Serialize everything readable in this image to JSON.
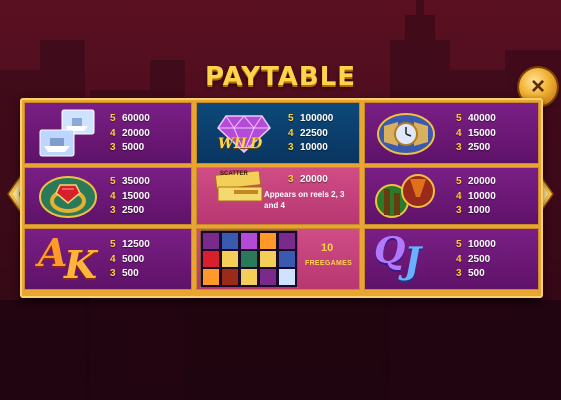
{
  "title": "PAYTABLE",
  "close_label": "×",
  "cells": {
    "yachts": {
      "pays": [
        [
          "5",
          "60000"
        ],
        [
          "4",
          "20000"
        ],
        [
          "3",
          "5000"
        ]
      ]
    },
    "wild": {
      "symbol_text": "WILD",
      "pays": [
        [
          "5",
          "100000"
        ],
        [
          "4",
          "22500"
        ],
        [
          "3",
          "10000"
        ]
      ]
    },
    "watch": {
      "pays": [
        [
          "5",
          "40000"
        ],
        [
          "4",
          "15000"
        ],
        [
          "3",
          "2500"
        ]
      ]
    },
    "ring": {
      "pays": [
        [
          "5",
          "35000"
        ],
        [
          "4",
          "15000"
        ],
        [
          "3",
          "2500"
        ]
      ]
    },
    "scatter": {
      "ticket_text": "SCATTER",
      "pays": [
        [
          "3",
          "20000"
        ]
      ],
      "note": "Appears on reels 2, 3 and 4"
    },
    "drinks": {
      "pays": [
        [
          "5",
          "20000"
        ],
        [
          "4",
          "10000"
        ],
        [
          "3",
          "1000"
        ]
      ]
    },
    "ak": {
      "letter_a": "A",
      "letter_k": "K",
      "pays": [
        [
          "5",
          "12500"
        ],
        [
          "4",
          "5000"
        ],
        [
          "3",
          "500"
        ]
      ]
    },
    "freegames": {
      "count": "10",
      "label": "FREEGAMES"
    },
    "qj": {
      "letter_q": "Q",
      "letter_j": "J",
      "pays": [
        [
          "5",
          "10000"
        ],
        [
          "4",
          "2500"
        ],
        [
          "3",
          "500"
        ]
      ]
    }
  },
  "colors": {
    "gold": "#ffd44a",
    "frame": "#e8a630",
    "purple": "#6a1876",
    "pink": "#c2407a",
    "blue": "#0b3f6e"
  }
}
